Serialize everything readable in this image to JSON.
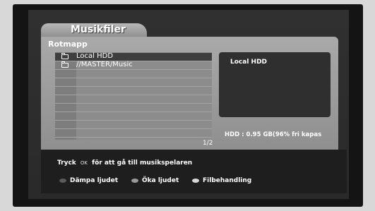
{
  "window": {
    "title": "Musikfiler"
  },
  "folder": {
    "name": "Rotmapp"
  },
  "file_list": {
    "items": [
      {
        "label": "Local HDD",
        "selected": true
      },
      {
        "label": "//MASTER/Music",
        "selected": false
      }
    ],
    "page": "1/2"
  },
  "info": {
    "title": "Local HDD",
    "capacity": "HDD : 0.95 GB(96% fri kapas"
  },
  "hint": {
    "prefix": "Tryck",
    "key": "OK",
    "suffix": "för att gå till musikspelaren"
  },
  "legend": {
    "items": [
      {
        "label": "Dämpa ljudet",
        "color": "#5a5a5a"
      },
      {
        "label": "Öka ljudet",
        "color": "#9a9a9a"
      },
      {
        "label": "Filbehandling",
        "color": "#d8d8d8"
      }
    ]
  }
}
